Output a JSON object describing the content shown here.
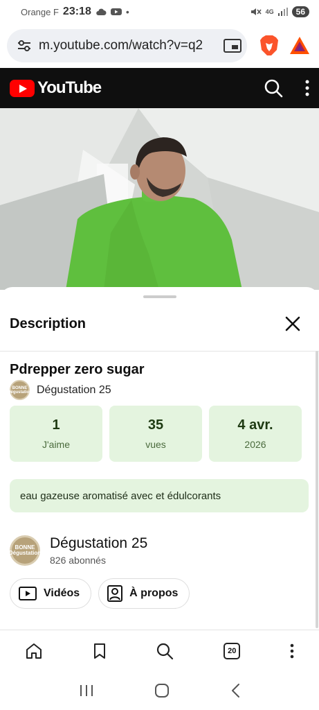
{
  "status_bar": {
    "carrier": "Orange F",
    "time": "23:18",
    "network": "4G",
    "battery": "56"
  },
  "browser": {
    "url": "m.youtube.com/watch?v=q2"
  },
  "header": {
    "logo_text": "YouTube"
  },
  "sheet": {
    "title": "Description",
    "video_title": "Pdrepper zero sugar",
    "channel_name": "Dégustation 25",
    "avatar_text": "BONNE Dégustation",
    "stats": [
      {
        "value": "1",
        "label": "J'aime"
      },
      {
        "value": "35",
        "label": "vues"
      },
      {
        "value": "4 avr.",
        "label": "2026"
      }
    ],
    "description": "eau gazeuse aromatisé avec et édulcorants",
    "channel": {
      "name": "Dégustation 25",
      "subscribers": "826 abonnés"
    },
    "chips": {
      "videos": "Vidéos",
      "about": "À propos"
    }
  },
  "bottom_bar": {
    "tab_count": "20"
  },
  "colors": {
    "youtube_red": "#ff0000",
    "stat_bg": "#e4f4df",
    "header_bg": "#0f0f0f"
  },
  "icons": [
    "settings-sliders-icon",
    "pip-icon",
    "brave-lion-icon",
    "bat-triangle-icon",
    "search-icon",
    "kebab-menu-icon",
    "close-icon",
    "play-box-icon",
    "portrait-icon",
    "home-icon",
    "bookmark-icon",
    "tabs-icon",
    "recents-icon",
    "home-circle-icon",
    "back-icon"
  ]
}
